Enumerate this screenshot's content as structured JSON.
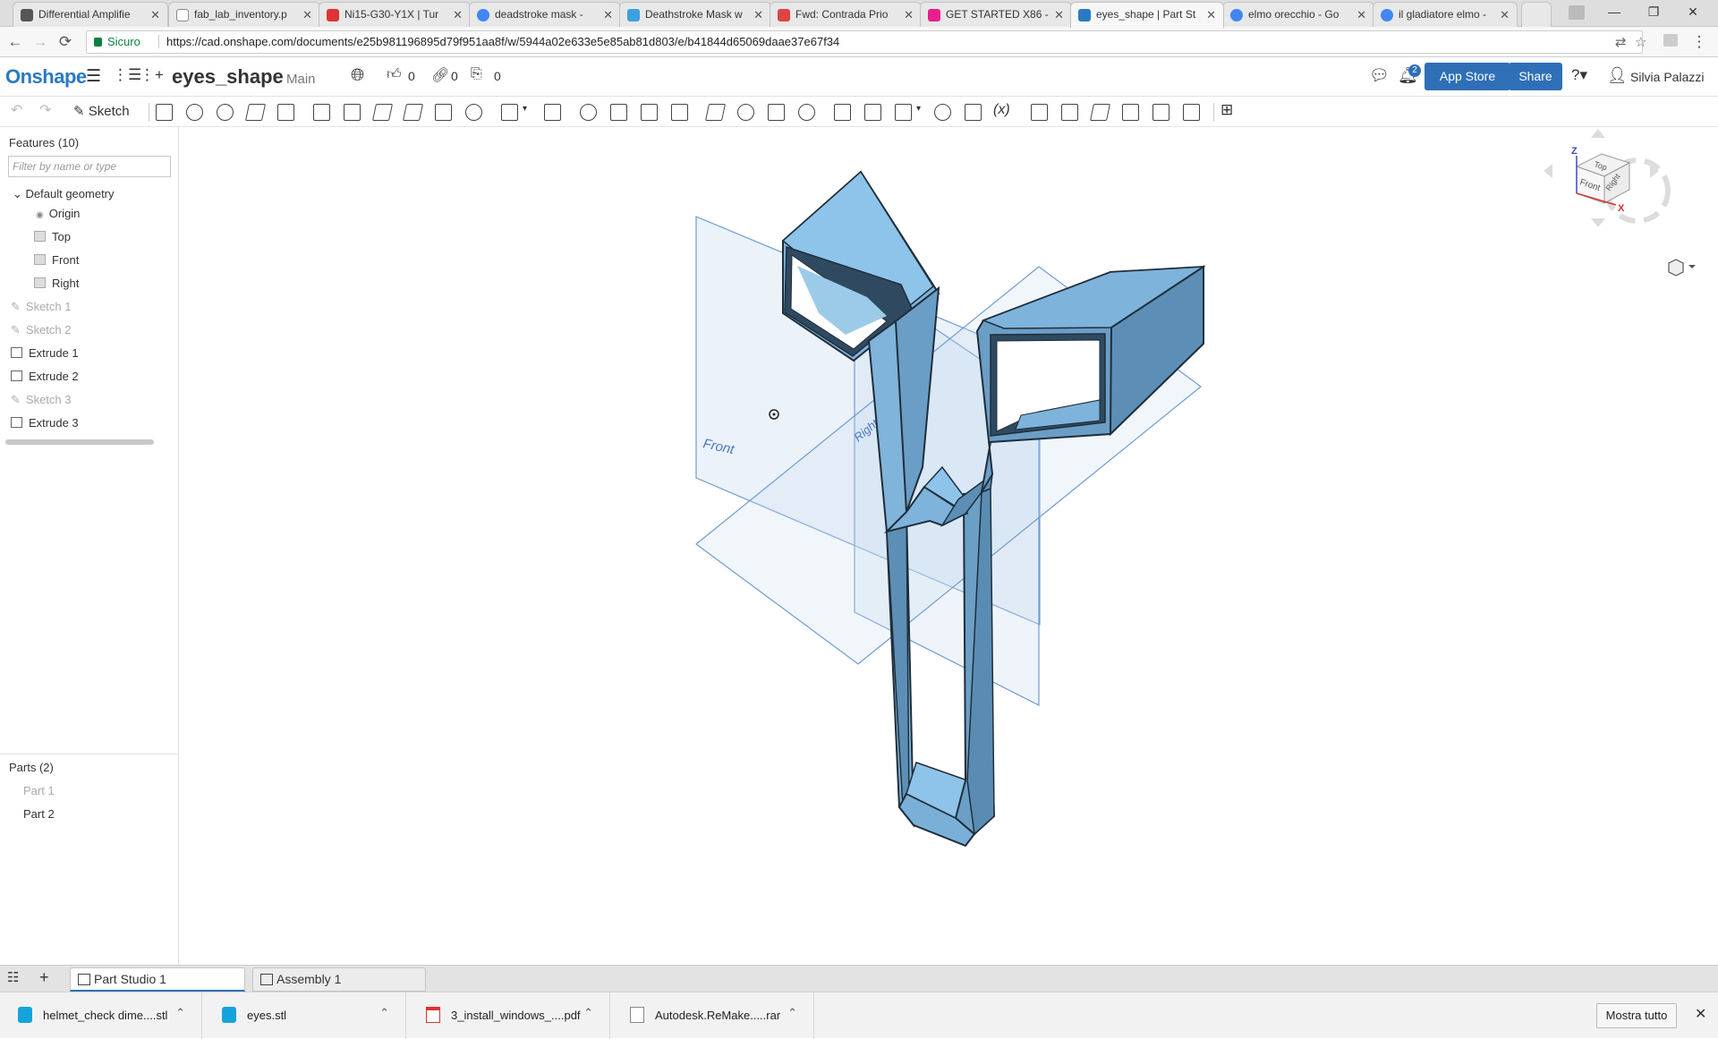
{
  "browser": {
    "tabs": [
      {
        "title": "Differential Amplifie",
        "color": "#555"
      },
      {
        "title": "fab_lab_inventory.p",
        "color": "#888"
      },
      {
        "title": "Ni15-G30-Y1X | Tur",
        "color": "#d33"
      },
      {
        "title": "deadstroke mask - ",
        "color": "#4285f4"
      },
      {
        "title": "Deathstroke Mask w",
        "color": "#3ea0e0"
      },
      {
        "title": "Fwd: Contrada Prio",
        "color": "#d44"
      },
      {
        "title": "GET STARTED X86 -",
        "color": "#e91e8c"
      },
      {
        "title": "eyes_shape | Part St",
        "color": "#2b79c2"
      },
      {
        "title": "elmo orecchio - Go",
        "color": "#4285f4"
      },
      {
        "title": "il gladiatore elmo -",
        "color": "#4285f4"
      }
    ],
    "secure_label": "Sicuro",
    "url": "https://cad.onshape.com/documents/e25b981196895d79f951aa8f/w/5944a02e633e5e85ab81d803/e/b41844d65069daae37e67f34"
  },
  "header": {
    "logo": "Onshape",
    "document_name": "eyes_shape",
    "workspace": "Main",
    "likes": "0",
    "links": "0",
    "copies": "0",
    "notifications": "2",
    "app_store": "App Store",
    "share": "Share",
    "user": "Silvia Palazzi"
  },
  "toolbar": {
    "sketch_label": "Sketch"
  },
  "features": {
    "title": "Features (10)",
    "filter_placeholder": "Filter by name or type",
    "default_geometry": "Default geometry",
    "items": [
      "Origin",
      "Top",
      "Front",
      "Right",
      "Sketch 1",
      "Sketch 2",
      "Extrude 1",
      "Extrude 2",
      "Sketch 3",
      "Extrude 3"
    ]
  },
  "parts": {
    "title": "Parts (2)",
    "items": [
      "Part 1",
      "Part 2"
    ]
  },
  "viewport": {
    "plane_front": "Front",
    "plane_right": "Right",
    "cube_top": "Top",
    "cube_front": "Front",
    "cube_right": "Right",
    "axis_z": "Z",
    "axis_x": "X",
    "part_color": "#8ec2e6",
    "part_edge": "#2a3b4a"
  },
  "bottom_tabs": {
    "part_studio": "Part Studio 1",
    "assembly": "Assembly 1"
  },
  "downloads": {
    "items": [
      "helmet_check dime....stl",
      "eyes.stl",
      "3_install_windows_....pdf",
      "Autodesk.ReMake.....rar"
    ],
    "show_all": "Mostra tutto"
  }
}
